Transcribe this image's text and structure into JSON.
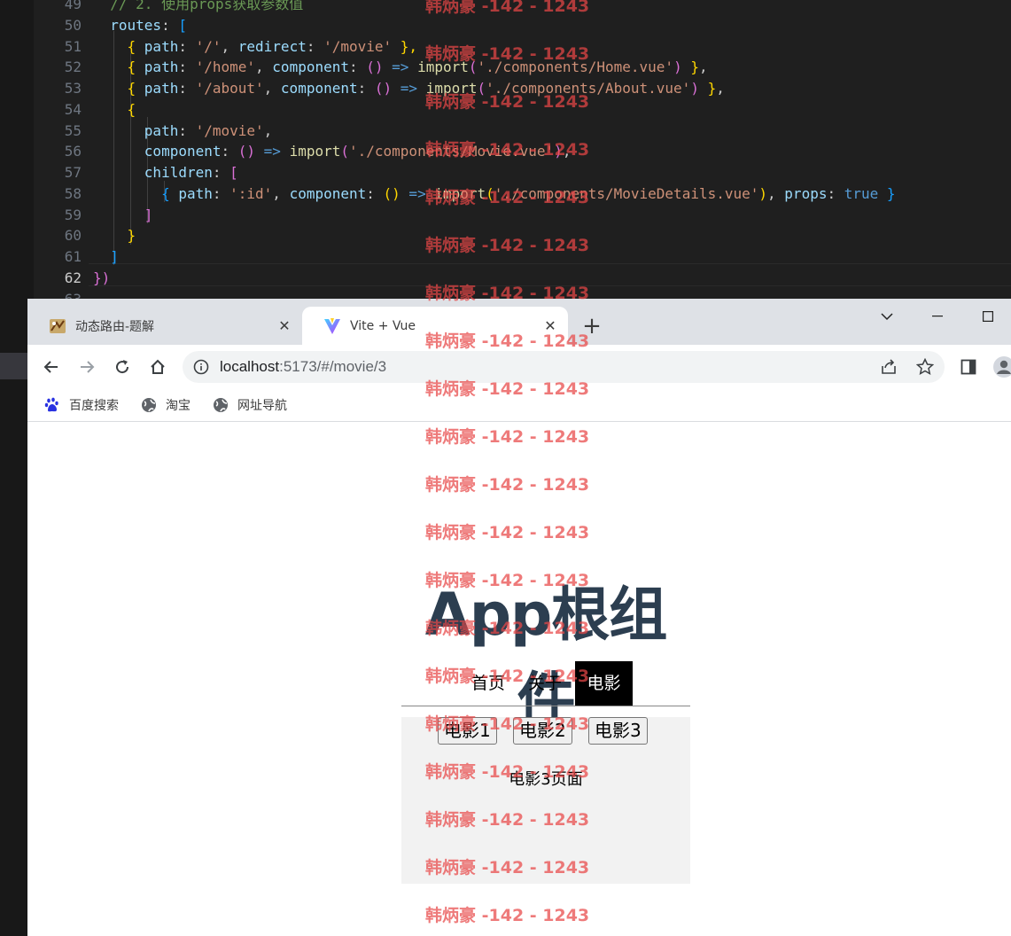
{
  "editor": {
    "lines": [
      {
        "num": "49",
        "segments": [
          [
            "c-comment",
            "  // 2. 使用props获取参数值"
          ]
        ]
      },
      {
        "num": "50",
        "segments": [
          [
            "c-prop",
            "  routes"
          ],
          [
            "c-txt",
            ": "
          ],
          [
            "c-b3",
            "["
          ]
        ]
      },
      {
        "num": "51",
        "segments": [
          [
            "c-b1",
            "    { "
          ],
          [
            "c-prop",
            "path"
          ],
          [
            "c-txt",
            ": "
          ],
          [
            "c-str",
            "'/'"
          ],
          [
            "c-txt",
            ", "
          ],
          [
            "c-prop",
            "redirect"
          ],
          [
            "c-txt",
            ": "
          ],
          [
            "c-str",
            "'/movie'"
          ],
          [
            "c-b1",
            " },"
          ]
        ]
      },
      {
        "num": "52",
        "segments": [
          [
            "c-b1",
            "    { "
          ],
          [
            "c-prop",
            "path"
          ],
          [
            "c-txt",
            ": "
          ],
          [
            "c-str",
            "'/home'"
          ],
          [
            "c-txt",
            ", "
          ],
          [
            "c-prop",
            "component"
          ],
          [
            "c-txt",
            ": "
          ],
          [
            "c-b2",
            "()"
          ],
          [
            "c-kw",
            " => "
          ],
          [
            "c-fn",
            "import"
          ],
          [
            "c-b2",
            "("
          ],
          [
            "c-str",
            "'./components/Home.vue'"
          ],
          [
            "c-b2",
            ")"
          ],
          [
            "c-b1",
            " }"
          ],
          [
            "c-txt",
            ","
          ]
        ]
      },
      {
        "num": "53",
        "segments": [
          [
            "c-b1",
            "    { "
          ],
          [
            "c-prop",
            "path"
          ],
          [
            "c-txt",
            ": "
          ],
          [
            "c-str",
            "'/about'"
          ],
          [
            "c-txt",
            ", "
          ],
          [
            "c-prop",
            "component"
          ],
          [
            "c-txt",
            ": "
          ],
          [
            "c-b2",
            "()"
          ],
          [
            "c-kw",
            " => "
          ],
          [
            "c-fn",
            "import"
          ],
          [
            "c-b2",
            "("
          ],
          [
            "c-str",
            "'./components/About.vue'"
          ],
          [
            "c-b2",
            ")"
          ],
          [
            "c-b1",
            " }"
          ],
          [
            "c-txt",
            ","
          ]
        ]
      },
      {
        "num": "54",
        "segments": [
          [
            "c-b1",
            "    {"
          ]
        ]
      },
      {
        "num": "55",
        "segments": [
          [
            "c-prop",
            "      path"
          ],
          [
            "c-txt",
            ": "
          ],
          [
            "c-str",
            "'/movie'"
          ],
          [
            "c-txt",
            ","
          ]
        ]
      },
      {
        "num": "56",
        "segments": [
          [
            "c-prop",
            "      component"
          ],
          [
            "c-txt",
            ": "
          ],
          [
            "c-b2",
            "()"
          ],
          [
            "c-kw",
            " => "
          ],
          [
            "c-fn",
            "import"
          ],
          [
            "c-b2",
            "("
          ],
          [
            "c-str",
            "'./components/Movie.vue'"
          ],
          [
            "c-b2",
            ")"
          ],
          [
            "c-txt",
            ","
          ]
        ]
      },
      {
        "num": "57",
        "segments": [
          [
            "c-prop",
            "      children"
          ],
          [
            "c-txt",
            ": "
          ],
          [
            "c-b2",
            "["
          ]
        ]
      },
      {
        "num": "58",
        "segments": [
          [
            "c-b3",
            "        { "
          ],
          [
            "c-prop",
            "path"
          ],
          [
            "c-txt",
            ": "
          ],
          [
            "c-str",
            "':id'"
          ],
          [
            "c-txt",
            ", "
          ],
          [
            "c-prop",
            "component"
          ],
          [
            "c-txt",
            ": "
          ],
          [
            "c-b1",
            "()"
          ],
          [
            "c-kw",
            " => "
          ],
          [
            "c-fn",
            "import"
          ],
          [
            "c-b1",
            "("
          ],
          [
            "c-str",
            "'./components/MovieDetails.vue'"
          ],
          [
            "c-b1",
            ")"
          ],
          [
            "c-txt",
            ", "
          ],
          [
            "c-prop",
            "props"
          ],
          [
            "c-txt",
            ": "
          ],
          [
            "c-kw",
            "true"
          ],
          [
            "c-b3",
            " }"
          ]
        ]
      },
      {
        "num": "59",
        "segments": [
          [
            "c-b2",
            "      ]"
          ]
        ]
      },
      {
        "num": "60",
        "segments": [
          [
            "c-b1",
            "    }"
          ]
        ]
      },
      {
        "num": "61",
        "segments": [
          [
            "c-b3",
            "  ]"
          ]
        ]
      },
      {
        "num": "62",
        "segments": [
          [
            "c-b2",
            "})"
          ]
        ]
      },
      {
        "num": "63",
        "segments": []
      }
    ]
  },
  "browser": {
    "tabs": [
      {
        "title": "动态路由-题解",
        "icon": "page-favicon-icon"
      },
      {
        "title": "Vite + Vue",
        "icon": "vite-favicon-icon"
      }
    ],
    "new_tab": "+",
    "close": "✕",
    "url_host": "localhost",
    "url_rest": ":5173/#/movie/3",
    "bookmarks": [
      {
        "label": "百度搜索",
        "icon": "baidu-paw-icon"
      },
      {
        "label": "淘宝",
        "icon": "globe-icon"
      },
      {
        "label": "网址导航",
        "icon": "globe-icon"
      }
    ]
  },
  "app": {
    "title": "App根组件",
    "nav": {
      "home": "首页",
      "about": "关于",
      "movie": "电影",
      "active": "movie"
    },
    "movie_buttons": [
      "电影1",
      "电影2",
      "电影3"
    ],
    "detail_text": "电影3页面"
  },
  "watermark": {
    "text": "韩炳豪 -142 - 1243",
    "color": "#e84646"
  }
}
